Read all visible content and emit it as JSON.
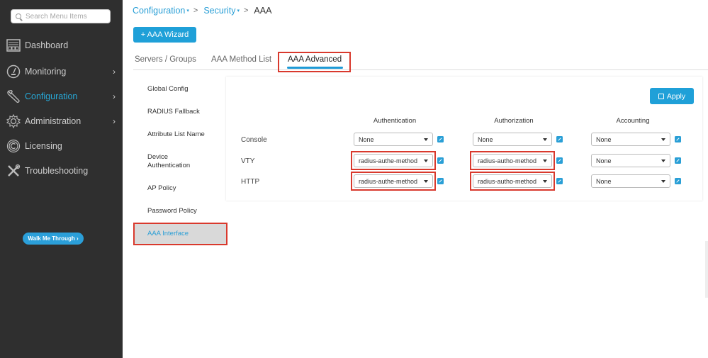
{
  "sidebar": {
    "search_placeholder": "Search Menu Items",
    "items": [
      {
        "label": "Dashboard",
        "icon": "dashboard-icon",
        "has_chevron": false
      },
      {
        "label": "Monitoring",
        "icon": "gauge-icon",
        "has_chevron": true
      },
      {
        "label": "Configuration",
        "icon": "wrench-icon",
        "has_chevron": true,
        "active": true
      },
      {
        "label": "Administration",
        "icon": "gear-icon",
        "has_chevron": true
      },
      {
        "label": "Licensing",
        "icon": "license-icon",
        "has_chevron": false
      },
      {
        "label": "Troubleshooting",
        "icon": "tools-icon",
        "has_chevron": false
      }
    ],
    "chevron": "›",
    "walk_me_through": "Walk Me Through ›"
  },
  "breadcrumb": {
    "items": [
      "Configuration",
      "Security"
    ],
    "current": "AAA",
    "caret": "▾",
    "separator": ">"
  },
  "wizard_button": "+ AAA Wizard",
  "tabs": [
    {
      "label": "Servers / Groups"
    },
    {
      "label": "AAA Method List"
    },
    {
      "label": "AAA Advanced",
      "active": true
    }
  ],
  "subnav": {
    "items": [
      "Global Config",
      "RADIUS Fallback",
      "Attribute List Name",
      "Device Authentication",
      "AP Policy",
      "Password Policy",
      "AAA Interface"
    ],
    "device_line1": "Device",
    "device_line2": "Authentication",
    "active": "AAA Interface"
  },
  "panel": {
    "apply_label": "Apply",
    "columns": [
      "Authentication",
      "Authorization",
      "Accounting"
    ],
    "rows": [
      {
        "label": "Console",
        "authentication": "None",
        "authorization": "None",
        "accounting": "None"
      },
      {
        "label": "VTY",
        "authentication": "radius-authe-method",
        "authorization": "radius-autho-method",
        "accounting": "None"
      },
      {
        "label": "HTTP",
        "authentication": "radius-authe-method",
        "authorization": "radius-autho-method",
        "accounting": "None"
      }
    ]
  },
  "colors": {
    "accent": "#1fa0d8",
    "highlight": "#d9392d",
    "sidebar_bg": "#2f2f2f"
  }
}
